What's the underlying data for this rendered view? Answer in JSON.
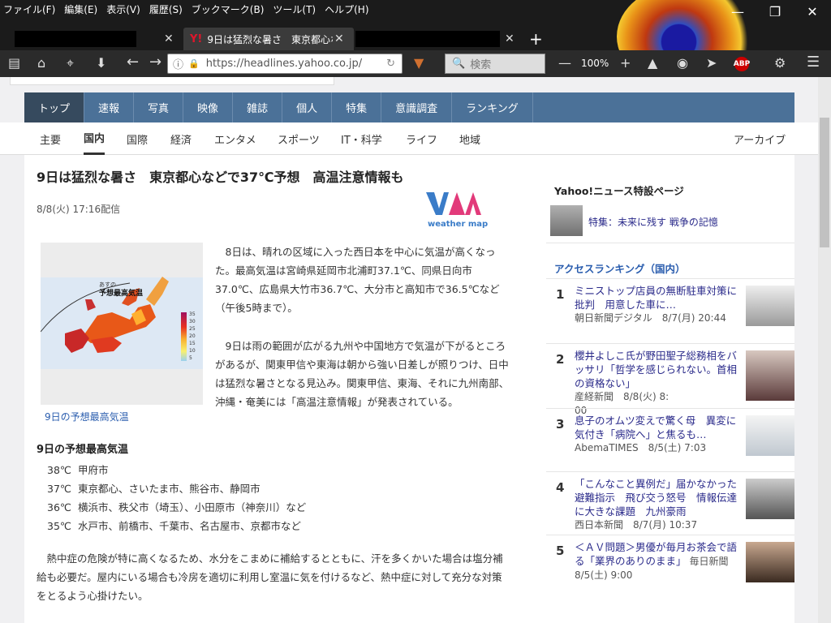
{
  "browser": {
    "menu": [
      "ファイル(F)",
      "編集(E)",
      "表示(V)",
      "履歴(S)",
      "ブックマーク(B)",
      "ツール(T)",
      "ヘルプ(H)"
    ],
    "tabs": [
      {
        "label": ""
      },
      {
        "label": "9日は猛烈な暑さ　東京都心など"
      },
      {
        "label": ""
      }
    ],
    "url": "https://headlines.yahoo.co.jp/",
    "search_placeholder": "検索",
    "zoom": "100%",
    "abp": "ABP"
  },
  "site": {
    "topnav": [
      "トップ",
      "速報",
      "写真",
      "映像",
      "雑誌",
      "個人",
      "特集",
      "意識調査",
      "ランキング"
    ],
    "subnav": [
      "主要",
      "国内",
      "国際",
      "経済",
      "エンタメ",
      "スポーツ",
      "IT・科学",
      "ライフ",
      "地域"
    ],
    "archive": "アーカイブ"
  },
  "article": {
    "headline": "9日は猛烈な暑さ　東京都心などで37℃予想　高温注意情報も",
    "date": "8/8(火) 17:16配信",
    "logo_text": "weather map",
    "map_title_small": "あすの",
    "map_title": "予想最高気温",
    "legend": [
      "35",
      "30",
      "25",
      "20",
      "15",
      "10",
      "5"
    ],
    "caption": "9日の予想最高気温",
    "para1": [
      "　8日は、晴れの区域に入った西日本を中心に気温が高くなっ",
      "た。最高気温は宮崎県延岡市北浦町37.1℃、同県日向市",
      "37.0℃、広島県大竹市36.7℃、大分市と高知市で36.5℃など",
      "（午後5時まで）。"
    ],
    "para2": [
      "　9日は雨の範囲が広がる九州や中国地方で気温が下がるところ",
      "があるが、関東甲信や東海は朝から強い日差しが照りつけ、日中",
      "は猛烈な暑さとなる見込み。関東甲信、東海、それに九州南部、",
      "沖縄・奄美には「高温注意情報」が発表されている。"
    ],
    "section": "9日の予想最高気温",
    "temps": [
      {
        "t": "38℃",
        "c": "甲府市"
      },
      {
        "t": "37℃",
        "c": "東京都心、さいたま市、熊谷市、静岡市"
      },
      {
        "t": "36℃",
        "c": "横浜市、秩父市（埼玉）、小田原市（神奈川）など"
      },
      {
        "t": "35℃",
        "c": "水戸市、前橋市、千葉市、名古屋市、京都市など"
      }
    ],
    "para3": [
      "　熱中症の危険が特に高くなるため、水分をこまめに補給するとともに、汗を多くかいた場合は塩分補",
      "給も必要だ。屋内にいる場合も冷房を適切に利用し室温に気を付けるなど、熱中症に対して充分な対策",
      "をとるよう心掛けたい。"
    ]
  },
  "sidebar": {
    "special_title": "Yahoo!ニュース特設ページ",
    "special_item": "特集：未来に残す 戦争の記憶",
    "ranking_title": "アクセスランキング（国内）",
    "ranking": [
      {
        "n": "1",
        "lines": [
          "ミニストップ店員の無断駐車対策に",
          "批判　用意した車に…"
        ],
        "src": "朝日新聞デジタル　8/7(月) 20:44"
      },
      {
        "n": "2",
        "lines": [
          "櫻井よしこ氏が野田聖子総務相をバ",
          "ッサリ「哲学を感じられない。首相",
          "の資格ない」"
        ],
        "src": "産経新聞　8/8(火) 8:",
        "src2": "00"
      },
      {
        "n": "3",
        "lines": [
          "息子のオムツ変えで驚く母　異変に",
          "気付き「病院へ」と焦るも…"
        ],
        "src": "AbemaTIMES　8/5(土) 7:03"
      },
      {
        "n": "4",
        "lines": [
          "「こんなこと異例だ」届かなかった",
          "避難指示　飛び交う怒号　情報伝達",
          "に大きな課題　九州豪雨"
        ],
        "src": "西日本新聞　8/7(月) 10:37"
      },
      {
        "n": "5",
        "lines": [
          "＜ＡＶ問題＞男優が毎月お茶会で語",
          "る「業界のありのまま」"
        ],
        "src": "毎日新聞",
        "src2": "8/5(土) 9:00"
      }
    ]
  }
}
